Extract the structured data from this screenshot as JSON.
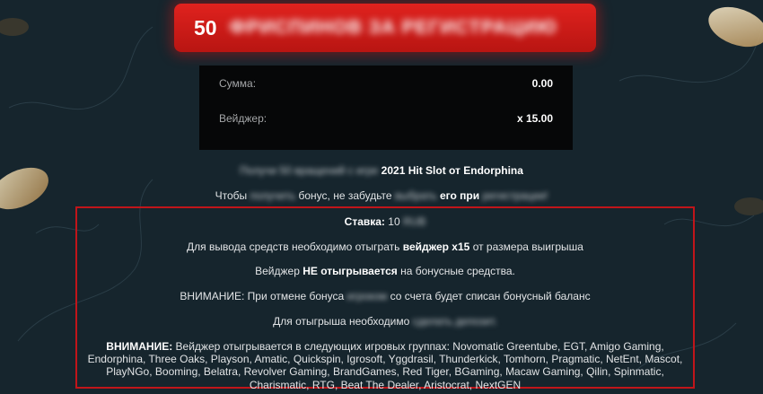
{
  "banner": {
    "number": "50",
    "text": "ФРИСПИНОВ ЗА РЕГИСТРАЦИЮ"
  },
  "summary": {
    "sum_label": "Сумма:",
    "sum_value": "0.00",
    "wager_label": "Вейджер:",
    "wager_value": "x 15.00"
  },
  "info": {
    "line1_blur": "Получи 50 вращений с игре",
    "line1_bold": "2021 Hit Slot от Endorphina",
    "line2_a": "Чтобы",
    "line2_blur1": "получить",
    "line2_b": "бонус, не забудьте",
    "line2_blur2": "выбрать",
    "line2_bold": "его при",
    "line2_blur3": "регистрации!"
  },
  "details": {
    "stake_label": "Ставка:",
    "stake_value": "10",
    "stake_blur": "RUB",
    "withdraw_a": "Для вывода средств необходимо отыграть",
    "withdraw_bold": "вейджер x15",
    "withdraw_b": "от размера выигрыша",
    "wager_a": "Вейджер",
    "wager_bold": "НЕ отыгрывается",
    "wager_b": "на бонусные средства.",
    "cancel_a": "ВНИМАНИЕ: При отмене бонуса",
    "cancel_blur": "игроком",
    "cancel_b": "со счета будет списан бонусный баланс",
    "play_a": "Для отыгрыша необходимо",
    "play_blur": "сделать депозит.",
    "groups_bold": "ВНИМАНИЕ:",
    "groups_text": "Вейджер отыгрывается в следующих игровых группах: Novomatic Greentube, EGT,  Amigo Gaming, Endorphina, Three Oaks, Playson, Amatic, Quickspin,  Igrosoft, Yggdrasil, Thunderkick, Tomhorn, Pragmatic, NetEnt, Mascot, PlayNGo, Booming, Belatra, Revolver Gaming, BrandGames, Red Tiger, BGaming, Macaw Gaming, Qilin, Spinmatic, Charismatic, RTG,  Beat The Dealer, Aristocrat, NextGEN"
  },
  "colors": {
    "background": "#16252d",
    "banner_red": "#d41b17",
    "box_black": "#060708",
    "border_red": "#c0151a"
  }
}
